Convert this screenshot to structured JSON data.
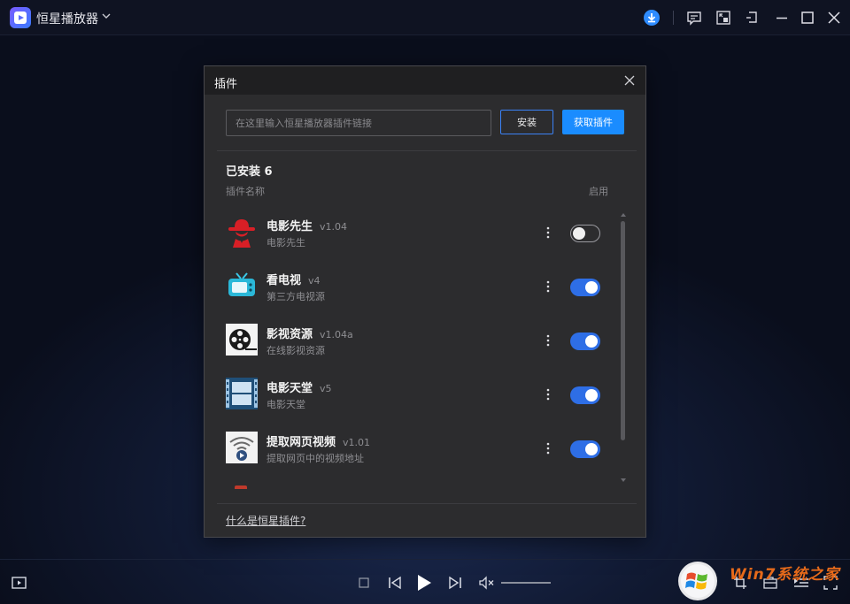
{
  "app": {
    "title": "恒星播放器"
  },
  "dialog": {
    "title": "插件",
    "url_input_placeholder": "在这里输入恒星播放器插件链接",
    "install_button": "安装",
    "get_plugins_button": "获取插件",
    "installed_label": "已安装 6",
    "column_name": "插件名称",
    "column_enable": "启用",
    "help_link": "什么是恒星插件?",
    "plugins": [
      {
        "name": "电影先生",
        "version": "v1.04",
        "description": "电影先生",
        "enabled": false,
        "icon": "spy-hat-icon"
      },
      {
        "name": "看电视",
        "version": "v4",
        "description": "第三方电视源",
        "enabled": true,
        "icon": "tv-icon"
      },
      {
        "name": "影视资源",
        "version": "v1.04a",
        "description": "在线影视资源",
        "enabled": true,
        "icon": "film-reel-icon"
      },
      {
        "name": "电影天堂",
        "version": "v5",
        "description": "电影天堂",
        "enabled": true,
        "icon": "film-paradise-icon"
      },
      {
        "name": "提取网页视频",
        "version": "v1.01",
        "description": "提取网页中的视频地址",
        "enabled": true,
        "icon": "wifi-play-icon"
      }
    ]
  },
  "watermark": {
    "text": "Win7系统之家"
  },
  "colors": {
    "accent": "#1a8cff",
    "toggle_on": "#2e6ee6",
    "dialog_bg": "#2c2c2e"
  }
}
